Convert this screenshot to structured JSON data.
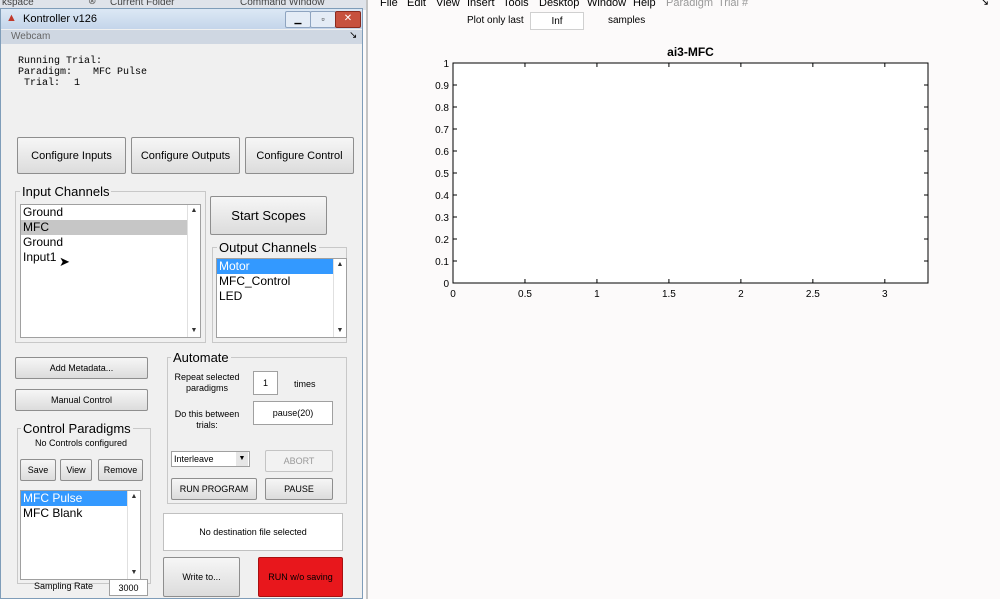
{
  "bg_tabs": [
    "kspace",
    "Current Folder",
    "Command Window"
  ],
  "menu": [
    "File",
    "Edit",
    "View",
    "Insert",
    "Tools",
    "Desktop",
    "Window",
    "Help",
    "Paradigm",
    "Trial #"
  ],
  "plot_only": {
    "label": "Plot only last",
    "value": "Inf",
    "suffix": "samples"
  },
  "window": {
    "title": "Kontroller v126",
    "panel": "Webcam",
    "dock_glyph": "↘"
  },
  "status": {
    "running": "Running Trial:",
    "paradigm_label": "Paradigm:",
    "paradigm_value": "MFC Pulse",
    "trial_label": "Trial:",
    "trial_value": "1"
  },
  "buttons": {
    "configure_inputs": "Configure Inputs",
    "configure_outputs": "Configure Outputs",
    "configure_control": "Configure Control",
    "start_scopes": "Start Scopes",
    "add_metadata": "Add Metadata...",
    "manual_control": "Manual Control",
    "save": "Save",
    "view": "View",
    "remove": "Remove",
    "abort": "ABORT",
    "run_program": "RUN PROGRAM",
    "pause": "PAUSE",
    "write_to": "Write to...",
    "run_wo_saving": "RUN w/o saving"
  },
  "input_channels": {
    "title": "Input Channels",
    "items": [
      "Ground",
      "MFC",
      "Ground",
      "Input1"
    ]
  },
  "output_channels": {
    "title": "Output Channels",
    "items": [
      "Motor",
      "MFC_Control",
      "LED"
    ]
  },
  "automate": {
    "title": "Automate",
    "repeat_label_1": "Repeat selected",
    "repeat_label_2": "paradigms",
    "repeat_value": "1",
    "times": "times",
    "between_label_1": "Do this between",
    "between_label_2": "trials:",
    "between_value": "pause(20)",
    "mode": "Interleave"
  },
  "control_paradigms": {
    "title": "Control Paradigms",
    "note": "No Controls configured",
    "items": [
      "MFC Pulse",
      "MFC Blank"
    ]
  },
  "destination": "No destination file selected",
  "sampling": {
    "label": "Sampling Rate",
    "value": "3000"
  },
  "colors": {
    "run_button": "#e8171c",
    "selection": "#3399ff"
  },
  "chart_data": {
    "type": "line",
    "title": "ai3-MFC",
    "xlabel": "",
    "ylabel": "",
    "xlim": [
      0,
      3.3
    ],
    "ylim": [
      0,
      1
    ],
    "xticks": [
      "0",
      "0.5",
      "1",
      "1.5",
      "2",
      "2.5",
      "3"
    ],
    "yticks": [
      "0",
      "0.1",
      "0.2",
      "0.3",
      "0.4",
      "0.5",
      "0.6",
      "0.7",
      "0.8",
      "0.9",
      "1"
    ],
    "series": []
  }
}
